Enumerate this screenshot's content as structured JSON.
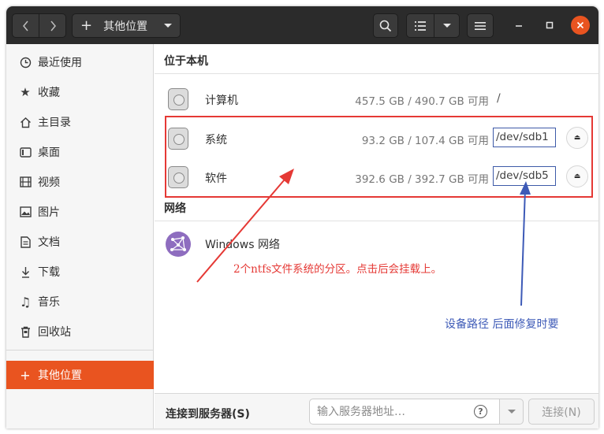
{
  "header": {
    "back_icon": "chevron-left-icon",
    "forward_icon": "chevron-right-icon",
    "path_icon": "plus-icon",
    "path_label": "其他位置"
  },
  "sidebar": {
    "items": [
      {
        "label": "最近使用",
        "icon": "clock-icon"
      },
      {
        "label": "收藏",
        "icon": "star-icon"
      },
      {
        "label": "主目录",
        "icon": "home-icon"
      },
      {
        "label": "桌面",
        "icon": "desktop-icon"
      },
      {
        "label": "视频",
        "icon": "video-icon"
      },
      {
        "label": "图片",
        "icon": "picture-icon"
      },
      {
        "label": "文档",
        "icon": "document-icon"
      },
      {
        "label": "下载",
        "icon": "download-icon"
      },
      {
        "label": "音乐",
        "icon": "music-icon"
      },
      {
        "label": "回收站",
        "icon": "trash-icon"
      }
    ],
    "other_locations": {
      "label": "其他位置",
      "icon": "plus-icon"
    }
  },
  "main": {
    "local_title": "位于本机",
    "devices": [
      {
        "name": "计算机",
        "usage": "457.5 GB / 490.7 GB 可用",
        "mount": "/"
      },
      {
        "name": "系统",
        "usage": "93.2 GB / 107.4 GB 可用",
        "mount": "/dev/sdb1"
      },
      {
        "name": "软件",
        "usage": "392.6 GB / 392.7 GB 可用",
        "mount": "/dev/sdb5"
      }
    ],
    "network_title": "网络",
    "network_items": [
      {
        "name": "Windows 网络"
      }
    ]
  },
  "annotations": {
    "red": "2个ntfs文件系统的分区。点击后会挂载上。",
    "blue": "设备路径  后面修复时要",
    "red_color": "#e53935",
    "blue_color": "#3d5ab7"
  },
  "bottom": {
    "connect_label": "连接到服务器(S)",
    "server_placeholder": "输入服务器地址…",
    "server_value": "",
    "connect_button": "连接(N)"
  },
  "colors": {
    "accent": "#e95420",
    "headerbar": "#2b2b2b"
  }
}
